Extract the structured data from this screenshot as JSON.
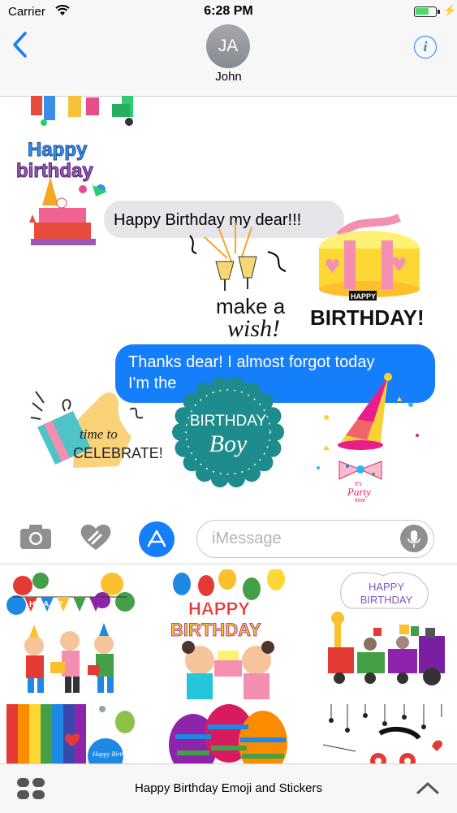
{
  "status_bar": {
    "carrier": "Carrier",
    "time": "6:28 PM",
    "battery_level": 0.7
  },
  "header": {
    "avatar_initials": "JA",
    "contact_name": "John",
    "back_icon": "chevron-left-icon",
    "info_icon": "info-icon"
  },
  "messages": [
    {
      "direction": "received",
      "text": "Happy Birthday my dear!!!"
    },
    {
      "direction": "sent",
      "line1": "Thanks dear! I almost forgot today",
      "line2": "I'm the"
    }
  ],
  "stickers": {
    "happy_birthday_kids": {
      "line1": "Happy",
      "line2": "birthday"
    },
    "make_a_wish": {
      "line1": "make a",
      "line2": "wish!"
    },
    "cake": {
      "label": "BIRTHDAY!",
      "small": "HAPPY"
    },
    "celebrate": {
      "line1": "time to",
      "line2": "CELEBRATE!"
    },
    "birthday_boy": {
      "line1": "BIRTHDAY",
      "line2": "Boy"
    },
    "party_hat": {
      "line1": "It's",
      "line2": "Party",
      "line3": "time"
    }
  },
  "input_bar": {
    "placeholder": "iMessage",
    "colors": {
      "accent": "#147efb",
      "icon": "#8e8e93"
    }
  },
  "drawer": {
    "items": [
      {
        "name": "happy-balloons-kids",
        "text": "HAPPY"
      },
      {
        "name": "happy-birthday-kids",
        "line1": "HAPPY",
        "line2": "BIRTHDAY"
      },
      {
        "name": "birthday-train",
        "line1": "HAPPY",
        "line2": "BIRTHDAY"
      },
      {
        "name": "rainbow-birthday",
        "text": "Happy Birthday"
      },
      {
        "name": "hot-air-balloons"
      },
      {
        "name": "hanging-spiders"
      }
    ]
  },
  "bottom_bar": {
    "app_name": "Happy Birthday Emoji and Stickers"
  }
}
